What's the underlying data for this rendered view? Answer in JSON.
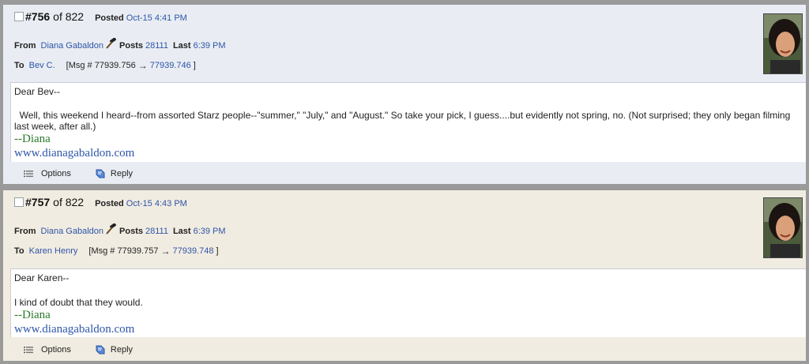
{
  "posts": [
    {
      "number": "#756",
      "of_total": "of 822",
      "posted_label": "Posted",
      "posted_time": "Oct-15 4:41 PM",
      "from_label": "From",
      "from_user": "Diana Gabaldon",
      "posts_label": "Posts",
      "posts_count": "28111",
      "last_label": "Last",
      "last_time": "6:39 PM",
      "to_label": "To",
      "to_user": "Bev C.",
      "msg_ref_prefix": "[Msg # 77939.756",
      "msg_ref_arrow": "→",
      "msg_ref_link": "77939.746",
      "msg_ref_suffix": "]",
      "greeting": "Dear Bev--",
      "message": "Well, this weekend I heard--from assorted Starz people--\"summer,\" \"July,\" and \"August.\"  So take your pick, I guess....but evidently not spring, no.  (Not surprised; they only began filming last week, after all.)",
      "signature": "--Diana",
      "website": "www.dianagabaldon.com",
      "options_label": "Options",
      "reply_label": "Reply",
      "icons": {
        "author_badge": "gavel-icon",
        "options": "options-list-icon",
        "reply": "reply-icon"
      }
    },
    {
      "number": "#757",
      "of_total": "of 822",
      "posted_label": "Posted",
      "posted_time": "Oct-15 4:43 PM",
      "from_label": "From",
      "from_user": "Diana Gabaldon",
      "posts_label": "Posts",
      "posts_count": "28111",
      "last_label": "Last",
      "last_time": "6:39 PM",
      "to_label": "To",
      "to_user": "Karen Henry",
      "msg_ref_prefix": "[Msg # 77939.757",
      "msg_ref_arrow": "→",
      "msg_ref_link": "77939.748",
      "msg_ref_suffix": "]",
      "greeting": "Dear Karen--",
      "message": "I kind of doubt that they would.",
      "signature": "--Diana",
      "website": "www.dianagabaldon.com",
      "options_label": "Options",
      "reply_label": "Reply",
      "icons": {
        "author_badge": "gavel-icon",
        "options": "options-list-icon",
        "reply": "reply-icon"
      }
    }
  ],
  "colors": {
    "link": "#2e55a8",
    "signature_green": "#2a7a2a",
    "post_a_bg": "#e9edf3",
    "post_b_bg": "#f1ece1"
  }
}
